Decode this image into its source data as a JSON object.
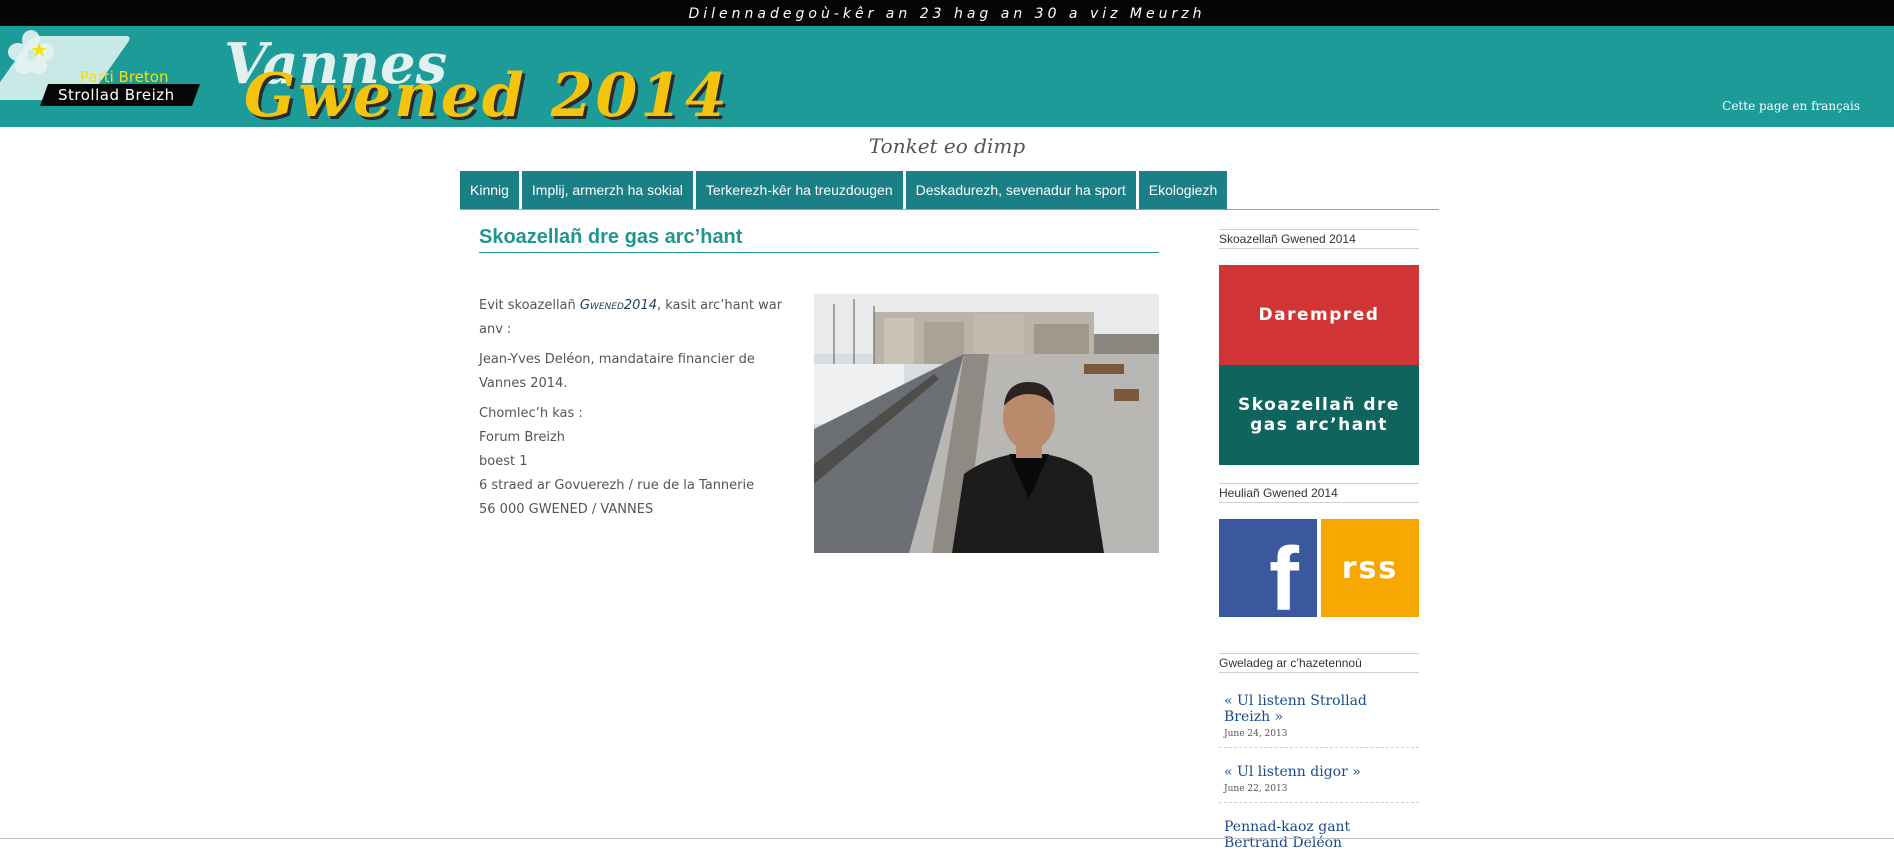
{
  "topbar": {
    "text": "Dilennadegoù-kêr an 23 hag an 30 a viz Meurzh"
  },
  "header": {
    "logo_line1": "Parti Breton",
    "logo_line2": "Strollad Breizh",
    "title_vannes": "Vannes",
    "title_gwened": "Gwened 2014",
    "lang_link": "Cette page en français"
  },
  "tagline": "Tonket eo dimp",
  "nav": {
    "items": [
      {
        "label": "Kinnig"
      },
      {
        "label": "Implij, armerzh ha sokial"
      },
      {
        "label": "Terkerezh-kêr ha treuzdougen"
      },
      {
        "label": "Deskadurezh, sevenadur ha sport"
      },
      {
        "label": "Ekologiezh"
      }
    ]
  },
  "post": {
    "title": "Skoazellañ dre gas arc’hant",
    "p1_before": "Evit skoazellañ ",
    "p1_brand": "Gwened2014",
    "p1_after": ", kasit arc’hant war anv :",
    "p2": "Jean-Yves Deléon, mandataire financier de Vannes 2014.",
    "address": [
      "Chomlec’h kas :",
      "Forum Breizh",
      "boest 1",
      "6 straed ar Govuerezh / rue de la Tannerie",
      "56 000 GWENED / VANNES"
    ]
  },
  "sidebar": {
    "widget1_title": "Skoazellañ Gwened 2014",
    "contact_label": "Darempred",
    "donate_label": "Skoazellañ dre gas arc’hant",
    "widget2_title": "Heuliañ Gwened 2014",
    "fb_label": "f",
    "rss_label": "rss",
    "widget3_title": "Gweladeg ar c’hazetennoù",
    "news": [
      {
        "title": "« Ul listenn Strollad Breizh »",
        "date": "June 24, 2013"
      },
      {
        "title": "« Ul listenn digor »",
        "date": "June 22, 2013"
      },
      {
        "title": "Pennad-kaoz gant Bertrand Deléon",
        "date": ""
      }
    ]
  },
  "colors": {
    "header_teal": "#1d9b99",
    "nav_teal": "#1a7f86",
    "title_gold": "#f4c40d",
    "contact_red": "#d13434",
    "donate_teal": "#0f645e",
    "facebook_blue": "#3b579d",
    "rss_orange": "#f6a800"
  }
}
